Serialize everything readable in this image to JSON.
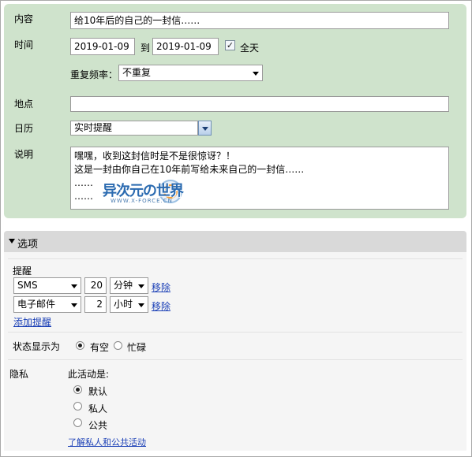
{
  "form": {
    "content_label": "内容",
    "content_value": "给10年后的自己的一封信……",
    "time_label": "时间",
    "start_date": "2019-01-09",
    "to_label": "到",
    "end_date": "2019-01-09",
    "allday_label": "全天",
    "allday_checked": true,
    "repeat_label": "重复频率：",
    "repeat_value": "不重复",
    "location_label": "地点",
    "location_value": "",
    "calendar_label": "日历",
    "calendar_value": "实时提醒",
    "desc_label": "说明",
    "desc_lines": [
      "嘿嘿，收到这封信时是不是很惊讶？！",
      "这是一封由你自己在10年前写给未来自己的一封信……",
      "……",
      "……"
    ]
  },
  "watermark": {
    "title": "异次元の世界",
    "subtitle": "WWW.X-FORCE.CN"
  },
  "options": {
    "header": "选项",
    "reminder_label": "提醒",
    "reminders": [
      {
        "method": "SMS",
        "amount": "20",
        "unit": "分钟",
        "remove": "移除"
      },
      {
        "method": "电子邮件",
        "amount": "2",
        "unit": "小时",
        "remove": "移除"
      }
    ],
    "add_reminder": "添加提醒",
    "status_label": "状态显示为",
    "status_options": [
      "有空",
      "忙碌"
    ],
    "status_selected": "有空",
    "privacy_label": "隐私",
    "privacy_prompt": "此活动是:",
    "privacy_options": [
      "默认",
      "私人",
      "公共"
    ],
    "privacy_selected": "默认",
    "privacy_link": "了解私人和公共活动"
  },
  "colors": {
    "panel_green": "#cfe3cc",
    "link_blue": "#1a3fb6",
    "options_bar": "#d9d9d9"
  }
}
